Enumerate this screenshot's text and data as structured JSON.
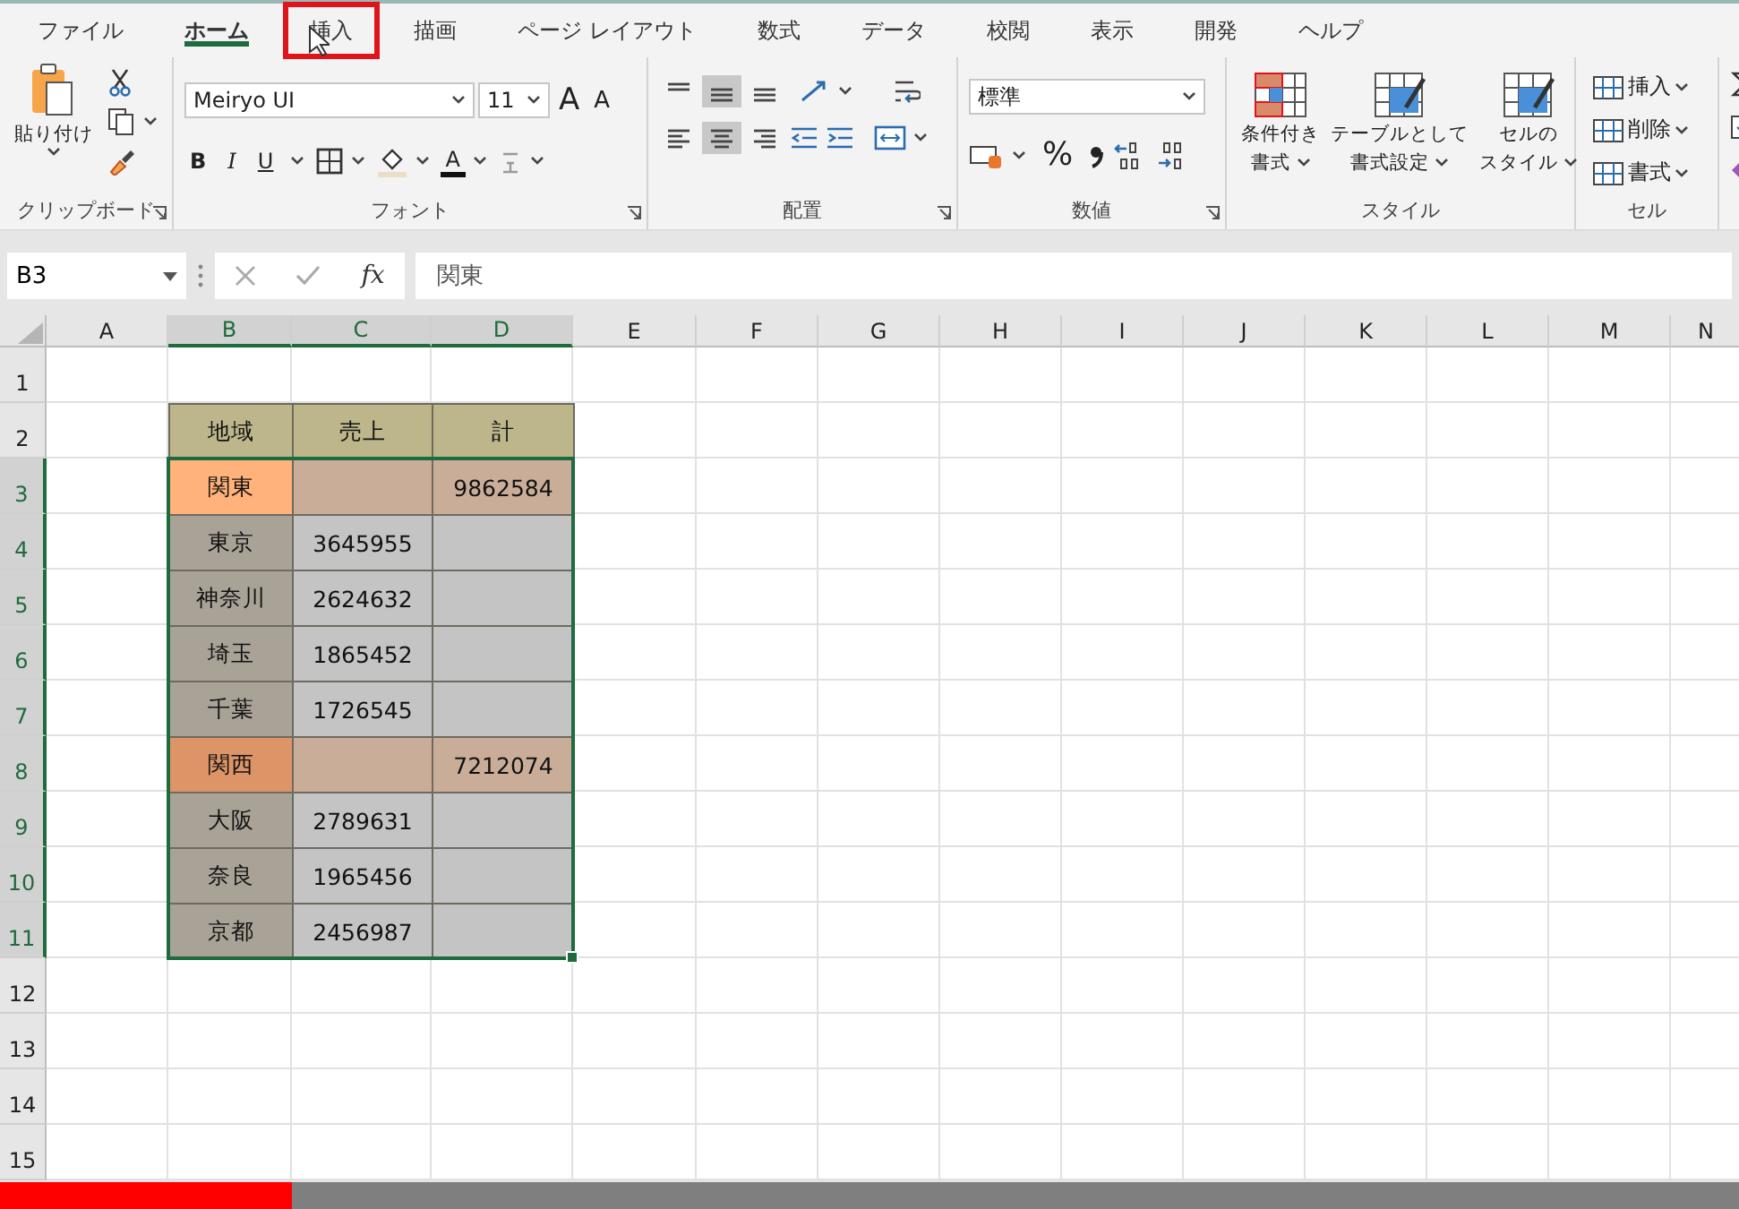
{
  "menu_tabs": [
    {
      "label": "ファイル",
      "selected": false,
      "highlighted": false
    },
    {
      "label": "ホーム",
      "selected": true,
      "highlighted": false
    },
    {
      "label": "挿入",
      "selected": false,
      "highlighted": true
    },
    {
      "label": "描画",
      "selected": false,
      "highlighted": false
    },
    {
      "label": "ページ レイアウト",
      "selected": false,
      "highlighted": false
    },
    {
      "label": "数式",
      "selected": false,
      "highlighted": false
    },
    {
      "label": "データ",
      "selected": false,
      "highlighted": false
    },
    {
      "label": "校閲",
      "selected": false,
      "highlighted": false
    },
    {
      "label": "表示",
      "selected": false,
      "highlighted": false
    },
    {
      "label": "開発",
      "selected": false,
      "highlighted": false
    },
    {
      "label": "ヘルプ",
      "selected": false,
      "highlighted": false
    }
  ],
  "ribbon": {
    "clipboard": {
      "paste": "貼り付け",
      "label": "クリップボード"
    },
    "font": {
      "name": "Meiryo UI",
      "size": "11",
      "grow": "A",
      "shrink": "A",
      "bold": "B",
      "italic": "I",
      "underline": "U",
      "color_letter": "A",
      "label": "フォント"
    },
    "alignment": {
      "label": "配置"
    },
    "number": {
      "format": "標準",
      "percent": "%",
      "label": "数値"
    },
    "styles": {
      "buttons": [
        {
          "line1": "条件付き",
          "line2": "書式"
        },
        {
          "line1": "テーブルとして",
          "line2": "書式設定"
        },
        {
          "line1": "セルの",
          "line2": "スタイル"
        }
      ],
      "label": "スタイル"
    },
    "cells": {
      "buttons": [
        "挿入",
        "削除",
        "書式"
      ],
      "label": "セル"
    }
  },
  "formula_bar": {
    "name_box": "B3",
    "fx": "fx",
    "formula": "関東"
  },
  "sheet": {
    "columns": [
      {
        "label": "A",
        "selected": false
      },
      {
        "label": "B",
        "selected": true
      },
      {
        "label": "C",
        "selected": true
      },
      {
        "label": "D",
        "selected": true
      },
      {
        "label": "E",
        "selected": false
      },
      {
        "label": "F",
        "selected": false
      },
      {
        "label": "G",
        "selected": false
      },
      {
        "label": "H",
        "selected": false
      },
      {
        "label": "I",
        "selected": false
      },
      {
        "label": "J",
        "selected": false
      },
      {
        "label": "K",
        "selected": false
      },
      {
        "label": "L",
        "selected": false
      },
      {
        "label": "M",
        "selected": false
      },
      {
        "label": "N",
        "selected": false
      }
    ],
    "rows": [
      {
        "label": "1",
        "selected": false
      },
      {
        "label": "2",
        "selected": false,
        "cells": [
          {
            "text": "地域",
            "color": "#bdb68b"
          },
          {
            "text": "売上",
            "color": "#bdb68b"
          },
          {
            "text": "計",
            "color": "#bdb68b"
          }
        ]
      },
      {
        "label": "3",
        "selected": true,
        "cells": [
          {
            "text": "関東",
            "color": "#ffb27a"
          },
          {
            "color": "#c9ad98"
          },
          {
            "text": "9862584",
            "color": "#c9ad98"
          }
        ]
      },
      {
        "label": "4",
        "selected": true,
        "cells": [
          {
            "text": "東京",
            "color": "#a9a296"
          },
          {
            "text": "3645955",
            "color": "#c4c4c4"
          },
          {
            "color": "#c4c4c4"
          }
        ]
      },
      {
        "label": "5",
        "selected": true,
        "cells": [
          {
            "text": "神奈川",
            "color": "#a9a296"
          },
          {
            "text": "2624632",
            "color": "#c4c4c4"
          },
          {
            "color": "#c4c4c4"
          }
        ]
      },
      {
        "label": "6",
        "selected": true,
        "cells": [
          {
            "text": "埼玉",
            "color": "#a9a296"
          },
          {
            "text": "1865452",
            "color": "#c4c4c4"
          },
          {
            "color": "#c4c4c4"
          }
        ]
      },
      {
        "label": "7",
        "selected": true,
        "cells": [
          {
            "text": "千葉",
            "color": "#a9a296"
          },
          {
            "text": "1726545",
            "color": "#c4c4c4"
          },
          {
            "color": "#c4c4c4"
          }
        ]
      },
      {
        "label": "8",
        "selected": true,
        "cells": [
          {
            "text": "関西",
            "color": "#dd9467"
          },
          {
            "color": "#c9ad98"
          },
          {
            "text": "7212074",
            "color": "#c9ad98"
          }
        ]
      },
      {
        "label": "9",
        "selected": true,
        "cells": [
          {
            "text": "大阪",
            "color": "#a9a296"
          },
          {
            "text": "2789631",
            "color": "#c4c4c4"
          },
          {
            "color": "#c4c4c4"
          }
        ]
      },
      {
        "label": "10",
        "selected": true,
        "cells": [
          {
            "text": "奈良",
            "color": "#a9a296"
          },
          {
            "text": "1965456",
            "color": "#c4c4c4"
          },
          {
            "color": "#c4c4c4"
          }
        ]
      },
      {
        "label": "11",
        "selected": true,
        "cells": [
          {
            "text": "京都",
            "color": "#a9a296"
          },
          {
            "text": "2456987",
            "color": "#c4c4c4"
          },
          {
            "color": "#c4c4c4"
          }
        ]
      },
      {
        "label": "12",
        "selected": false
      },
      {
        "label": "13",
        "selected": false
      },
      {
        "label": "14",
        "selected": false
      },
      {
        "label": "15",
        "selected": false
      }
    ]
  },
  "progress": {
    "level": 0.168
  }
}
